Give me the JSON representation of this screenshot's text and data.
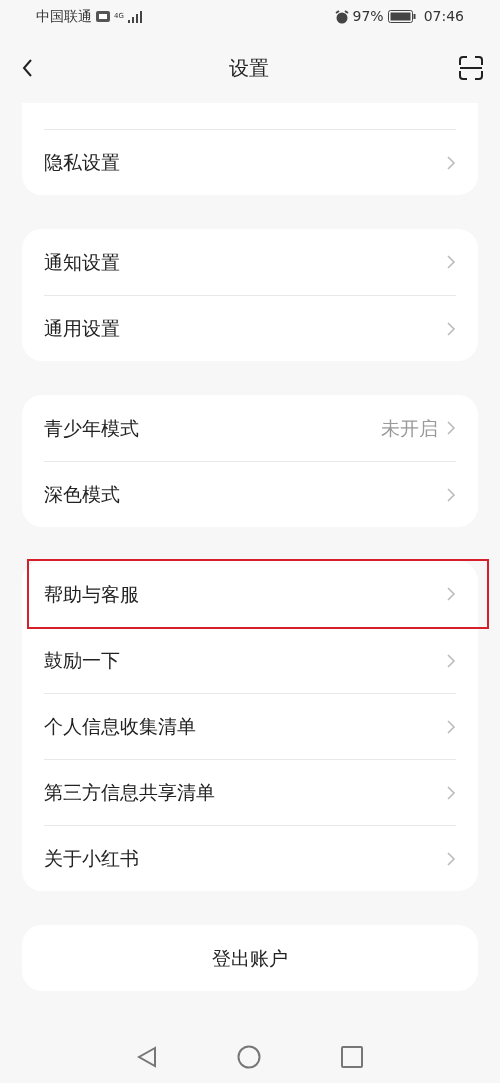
{
  "status_bar": {
    "carrier": "中国联通",
    "network": "4G",
    "battery": "97%",
    "time": "07:46"
  },
  "header": {
    "title": "设置"
  },
  "groups": [
    {
      "items": [
        {
          "label": "隐私设置",
          "highlighted": false
        }
      ]
    },
    {
      "items": [
        {
          "label": "通知设置",
          "highlighted": false
        },
        {
          "label": "通用设置",
          "highlighted": false
        }
      ]
    },
    {
      "items": [
        {
          "label": "青少年模式",
          "value": "未开启",
          "highlighted": false
        },
        {
          "label": "深色模式",
          "highlighted": false
        }
      ]
    },
    {
      "items": [
        {
          "label": "帮助与客服",
          "highlighted": true
        },
        {
          "label": "鼓励一下",
          "highlighted": false
        },
        {
          "label": "个人信息收集清单",
          "highlighted": false
        },
        {
          "label": "第三方信息共享清单",
          "highlighted": false
        },
        {
          "label": "关于小红书",
          "highlighted": false
        }
      ]
    }
  ],
  "logout": "登出账户"
}
